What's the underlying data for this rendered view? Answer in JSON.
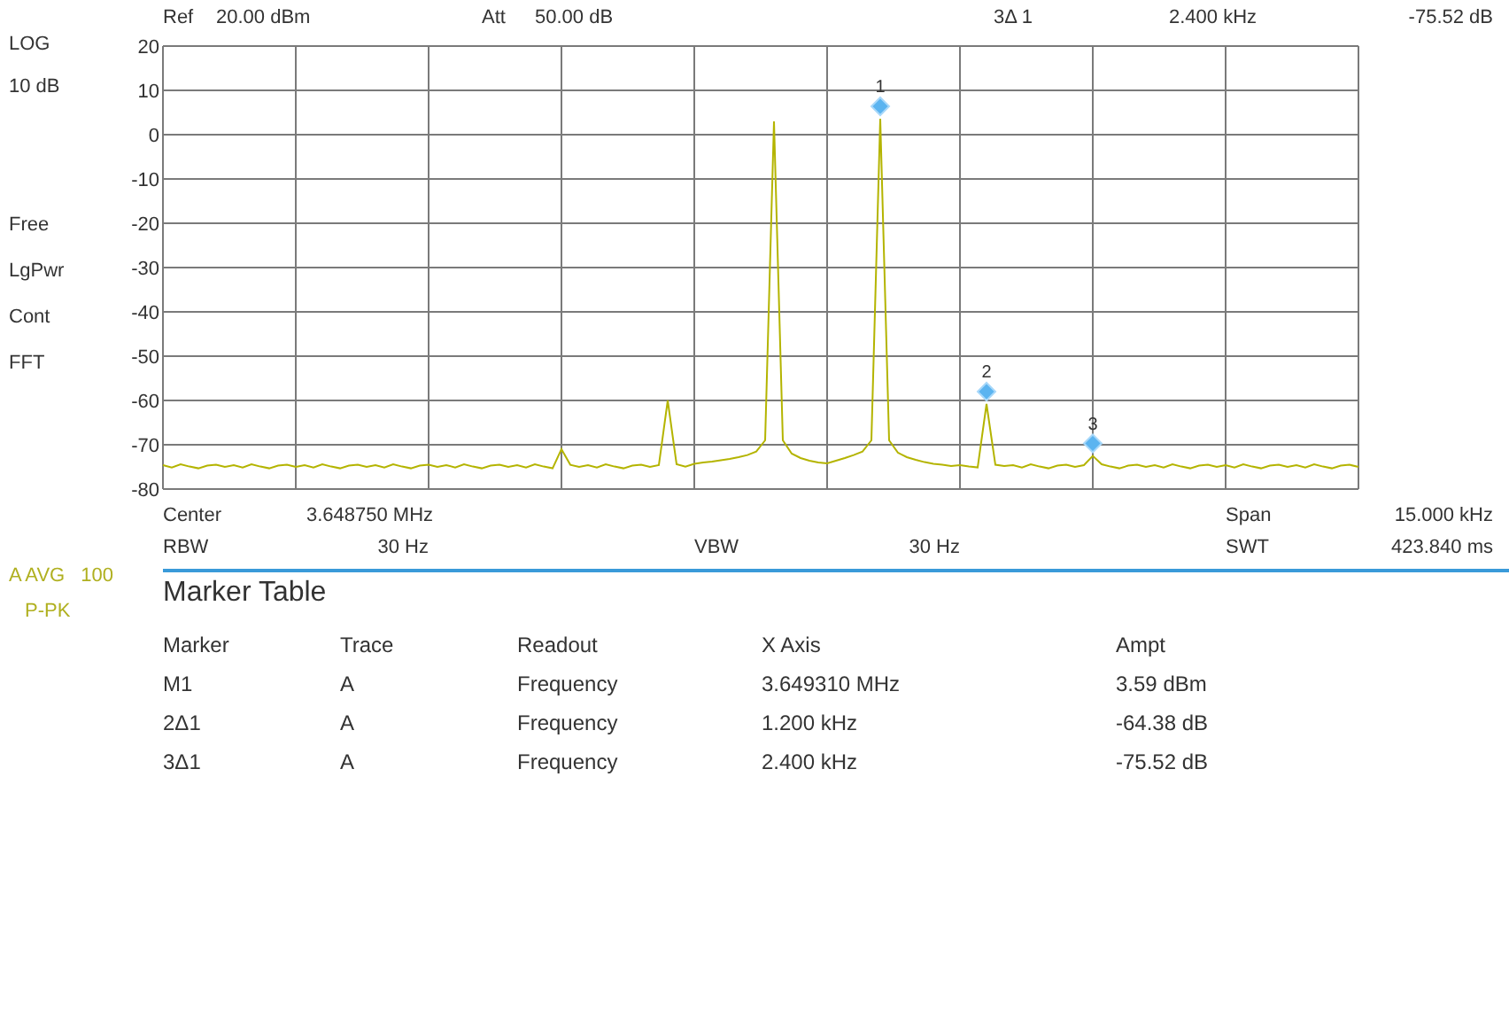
{
  "left_panel": {
    "scale": [
      "LOG",
      "10 dB"
    ],
    "settings": [
      "Free",
      "LgPwr",
      "Cont",
      "FFT"
    ],
    "trace_info": {
      "trace": "A AVG",
      "count": "100",
      "detector": "P-PK"
    }
  },
  "header": {
    "ref_label": "Ref",
    "ref_value": "20.00 dBm",
    "att_label": "Att",
    "att_value": "50.00 dB",
    "marker": "3Δ 1",
    "marker_x": "2.400 kHz",
    "marker_y": "-75.52 dB"
  },
  "chart_data": {
    "type": "line",
    "grid": true,
    "ylim": [
      -80,
      20
    ],
    "yticks": [
      20,
      10,
      0,
      -10,
      -20,
      -30,
      -40,
      -50,
      -60,
      -70,
      -80
    ],
    "categories": [
      null,
      null,
      null,
      null,
      null,
      null,
      null,
      null,
      null,
      null,
      null,
      null,
      null,
      null,
      null,
      null,
      null,
      null,
      null,
      null,
      null,
      null,
      null,
      null,
      null,
      null,
      null,
      null,
      null,
      null,
      null,
      null,
      null,
      null,
      null,
      null,
      null,
      null,
      null,
      null,
      null,
      null,
      null,
      null,
      null,
      null,
      null,
      null,
      null,
      null,
      null,
      null,
      null,
      null,
      null,
      null,
      null,
      null,
      null,
      null,
      null,
      null,
      null,
      null,
      null,
      null,
      null,
      null,
      null,
      null,
      null,
      null,
      null,
      null,
      null,
      null,
      null,
      null,
      null,
      null,
      null,
      null,
      null,
      null,
      null,
      null,
      null,
      null,
      null,
      null,
      null,
      null,
      null,
      null,
      null,
      null,
      null,
      null,
      null,
      null,
      null,
      null,
      null,
      null,
      null,
      null,
      null,
      null,
      null,
      null,
      null,
      null,
      null,
      null,
      null,
      null,
      null,
      null,
      null,
      null,
      null,
      null,
      null,
      null,
      null,
      null,
      null,
      null,
      null,
      null,
      null,
      null,
      null,
      null,
      null,
      null
    ],
    "series": [
      {
        "color": "#b4b400",
        "values": [
          -74.6,
          -75.1,
          -74.4,
          -74.9,
          -75.3,
          -74.7,
          -74.5,
          -75.0,
          -74.6,
          -75.1,
          -74.4,
          -74.9,
          -75.3,
          -74.7,
          -74.5,
          -75.0,
          -74.6,
          -75.1,
          -74.4,
          -74.9,
          -75.3,
          -74.7,
          -74.5,
          -75.0,
          -74.6,
          -75.1,
          -74.4,
          -74.9,
          -75.3,
          -74.7,
          -74.5,
          -75.0,
          -74.6,
          -75.1,
          -74.4,
          -74.9,
          -75.3,
          -74.7,
          -74.5,
          -75.0,
          -74.6,
          -75.1,
          -74.4,
          -74.9,
          -75.3,
          -71,
          -74.5,
          -75.0,
          -74.6,
          -75.1,
          -74.4,
          -74.9,
          -75.3,
          -74.7,
          -74.5,
          -75.0,
          -74.6,
          -60,
          -74.4,
          -74.9,
          -74.3,
          -74.0,
          -73.8,
          -73.5,
          -73.2,
          -72.8,
          -72.3,
          -71.5,
          -69,
          3,
          -69,
          -72,
          -73,
          -73.6,
          -74.0,
          -74.2,
          -73.6,
          -73,
          -72.3,
          -71.5,
          -69,
          3.6,
          -69,
          -71.8,
          -72.8,
          -73.4,
          -73.9,
          -74.3,
          -74.5,
          -74.8,
          -74.6,
          -74.9,
          -75.1,
          -60.8,
          -74.5,
          -74.8,
          -74.6,
          -75.1,
          -74.4,
          -74.9,
          -75.3,
          -74.7,
          -74.5,
          -75.0,
          -74.6,
          -72.5,
          -74.4,
          -74.9,
          -75.3,
          -74.7,
          -74.5,
          -75.0,
          -74.6,
          -75.1,
          -74.4,
          -74.9,
          -75.3,
          -74.7,
          -74.5,
          -75.0,
          -74.6,
          -75.1,
          -74.4,
          -74.9,
          -75.3,
          -74.7,
          -74.5,
          -75.0,
          -74.6,
          -75.1,
          -74.4,
          -74.9,
          -75.3,
          -74.7,
          -74.5,
          -75.0
        ]
      }
    ]
  },
  "markers": [
    {
      "label": "1"
    },
    {
      "label": "2"
    },
    {
      "label": "3"
    }
  ],
  "footer": {
    "center_label": "Center",
    "center_value": "3.648750 MHz",
    "span_label": "Span",
    "span_value": "15.000 kHz",
    "rbw_label": "RBW",
    "rbw_value": "30 Hz",
    "vbw_label": "VBW",
    "vbw_value": "30 Hz",
    "swt_label": "SWT",
    "swt_value": "423.840 ms"
  },
  "marker_table": {
    "title": "Marker Table",
    "columns": [
      "Marker",
      "Trace",
      "Readout",
      "X Axis",
      "Ampt"
    ],
    "rows": [
      [
        "M1",
        "A",
        "Frequency",
        "3.649310 MHz",
        "3.59 dBm"
      ],
      [
        "2Δ1",
        "A",
        "Frequency",
        "1.200 kHz",
        "-64.38 dB"
      ],
      [
        "3Δ1",
        "A",
        "Frequency",
        "2.400 kHz",
        "-75.52 dB"
      ]
    ]
  }
}
